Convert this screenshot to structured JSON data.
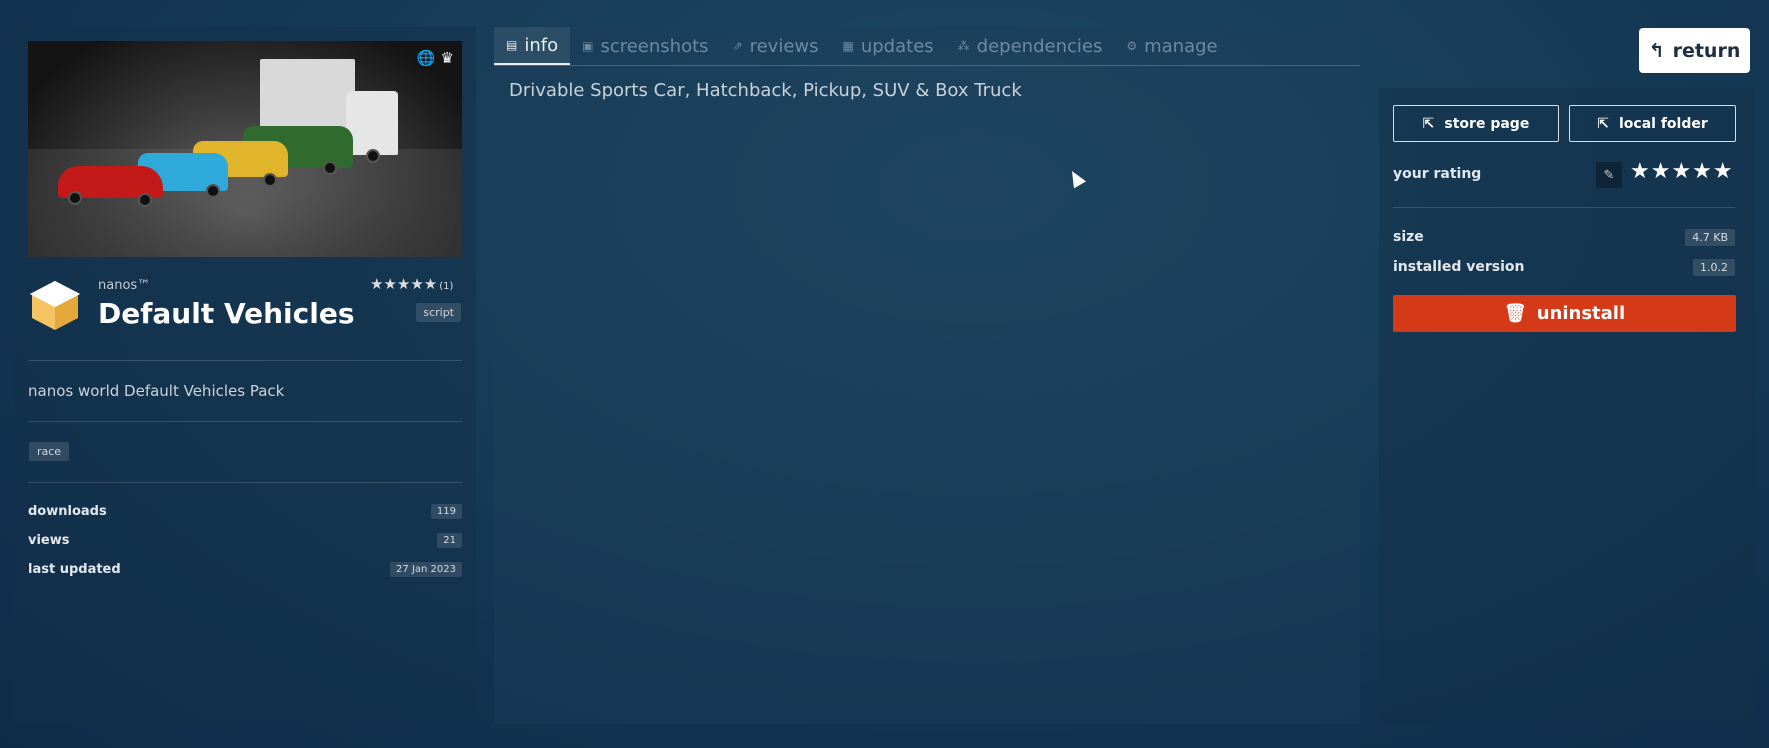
{
  "tabs": [
    {
      "label": "info",
      "icon": "document-icon",
      "active": true
    },
    {
      "label": "screenshots",
      "icon": "image-icon",
      "active": false
    },
    {
      "label": "reviews",
      "icon": "share-icon",
      "active": false
    },
    {
      "label": "updates",
      "icon": "copy-icon",
      "active": false
    },
    {
      "label": "dependencies",
      "icon": "nodes-icon",
      "active": false
    },
    {
      "label": "manage",
      "icon": "gear-icon",
      "active": false
    }
  ],
  "return_label": "return",
  "package": {
    "author": "nanos™",
    "title": "Default Vehicles",
    "stars": "★★★★★",
    "rating_count": "(1)",
    "type": "script",
    "description": "nanos world Default Vehicles Pack",
    "tag": "race",
    "stats": [
      {
        "label": "downloads",
        "value": "119"
      },
      {
        "label": "views",
        "value": "21"
      },
      {
        "label": "last updated",
        "value": "27 Jan 2023"
      }
    ]
  },
  "content": {
    "text": "Drivable Sports Car, Hatchback, Pickup, SUV & Box Truck"
  },
  "actions": {
    "store_page": "store page",
    "local_folder": "local folder",
    "your_rating": "your rating",
    "rating_stars": "★★★★★",
    "size_label": "size",
    "size_value": "4.7 KB",
    "installed_version_label": "installed version",
    "installed_version_value": "1.0.2",
    "uninstall": "uninstall"
  },
  "colors": {
    "accent_danger": "#d43a17",
    "background": "#173d58"
  }
}
